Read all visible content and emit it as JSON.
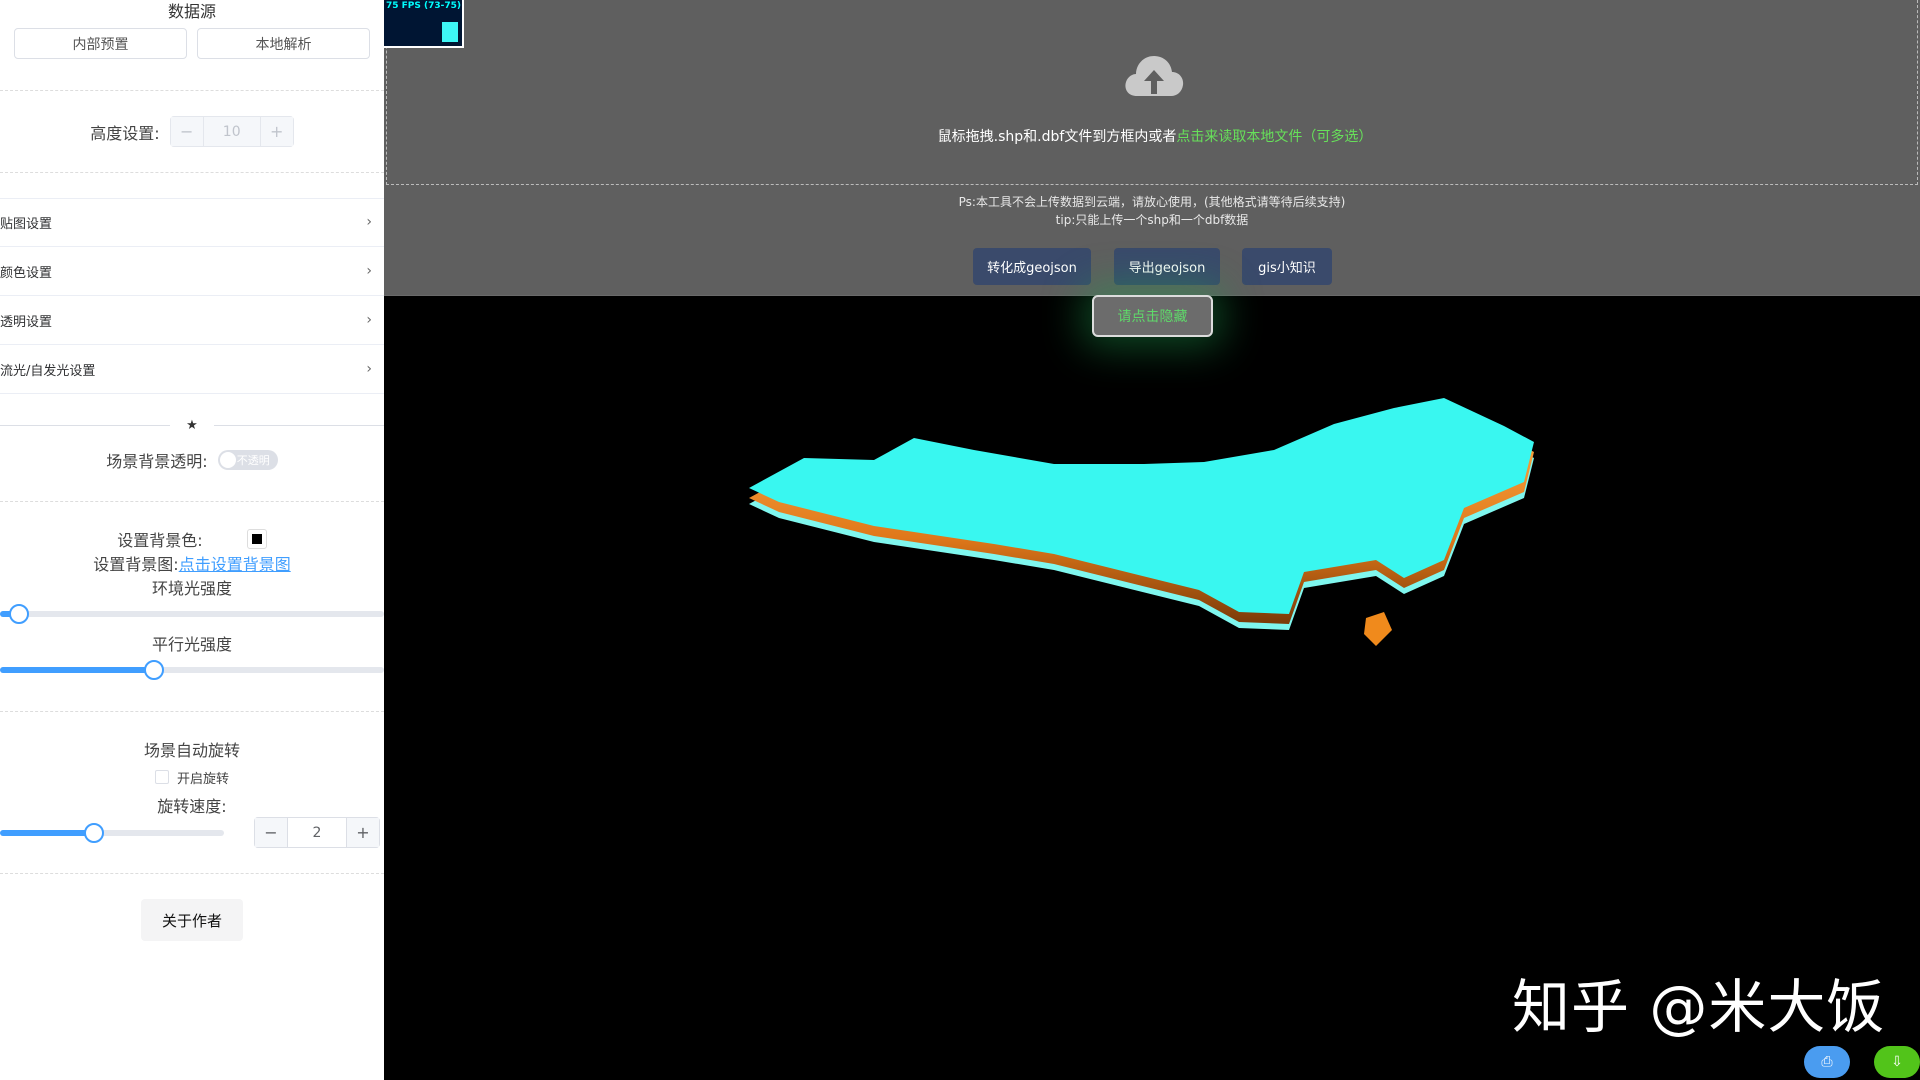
{
  "sidebar": {
    "data_source": {
      "title": "数据源",
      "internal_btn": "内部预置",
      "local_btn": "本地解析"
    },
    "height": {
      "label": "高度设置:",
      "minus": "−",
      "value": "10",
      "plus": "+"
    },
    "collapse_items": [
      {
        "label": "贴图设置"
      },
      {
        "label": "颜色设置"
      },
      {
        "label": "透明设置"
      },
      {
        "label": "流光/自发光设置"
      }
    ],
    "divider_star": "★",
    "bg_transparent": {
      "label": "场景背景透明:",
      "toggle_text": "不透明"
    },
    "bg_color_label": "设置背景色:",
    "bg_image": {
      "label": "设置背景图:",
      "link": "点击设置背景图"
    },
    "ambient": {
      "label": "环境光强度",
      "value_fraction": 0.05
    },
    "directional": {
      "label": "平行光强度",
      "value_fraction": 0.4
    },
    "rotation": {
      "title": "场景自动旋转",
      "checkbox_label": "开启旋转",
      "speed_label": "旋转速度:",
      "speed_fraction": 0.42,
      "minus": "−",
      "value": "2",
      "plus": "+"
    },
    "about_btn": "关于作者"
  },
  "main": {
    "fps_text": "75 FPS (73-75)",
    "upload": {
      "text": "鼠标拖拽.shp和.dbf文件到方框内或者",
      "link": "点击来读取本地文件（可多选）",
      "note1": "Ps:本工具不会上传数据到云端，请放心使用，(其他格式请等待后续支持)",
      "note2": "tip:只能上传一个shp和一个dbf数据"
    },
    "actions": {
      "to_geojson": "转化成geojson",
      "export_geojson": "导出geojson",
      "gis_tips": "gis小知识"
    },
    "collapse_btn": "请点击隐藏",
    "watermark": "知乎 @米大饭",
    "colors": {
      "map_top": "#39f7f0",
      "map_side": "#f08a1c",
      "accent": "#409eff",
      "green": "#67e05a"
    }
  }
}
